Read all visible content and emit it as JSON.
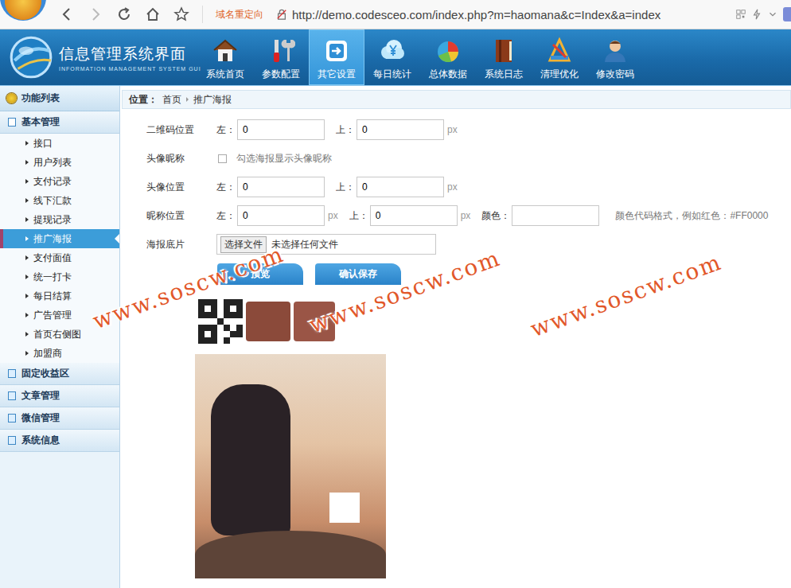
{
  "browser": {
    "redirect_label": "域名重定向",
    "url": "http://demo.codesceo.com/index.php?m=haomana&c=Index&a=index"
  },
  "header": {
    "title": "信息管理系统界面",
    "subtitle": "INFORMATION MANAGEMENT SYSTEM GUI",
    "nav": [
      {
        "label": "系统首页",
        "selected": false
      },
      {
        "label": "参数配置",
        "selected": false
      },
      {
        "label": "其它设置",
        "selected": true
      },
      {
        "label": "每日统计",
        "selected": false
      },
      {
        "label": "总体数据",
        "selected": false
      },
      {
        "label": "系统日志",
        "selected": false
      },
      {
        "label": "清理优化",
        "selected": false
      },
      {
        "label": "修改密码",
        "selected": false
      }
    ]
  },
  "sidebar": {
    "title": "功能列表",
    "groups": [
      {
        "label": "基本管理",
        "expanded": true,
        "items": [
          {
            "label": "接口",
            "selected": false
          },
          {
            "label": "用户列表",
            "selected": false
          },
          {
            "label": "支付记录",
            "selected": false
          },
          {
            "label": "线下汇款",
            "selected": false
          },
          {
            "label": "提现记录",
            "selected": false
          },
          {
            "label": "推广海报",
            "selected": true
          },
          {
            "label": "支付面值",
            "selected": false
          },
          {
            "label": "统一打卡",
            "selected": false
          },
          {
            "label": "每日结算",
            "selected": false
          },
          {
            "label": "广告管理",
            "selected": false
          },
          {
            "label": "首页右侧图",
            "selected": false
          },
          {
            "label": "加盟商",
            "selected": false
          }
        ]
      },
      {
        "label": "固定收益区",
        "expanded": false,
        "items": []
      },
      {
        "label": "文章管理",
        "expanded": false,
        "items": []
      },
      {
        "label": "微信管理",
        "expanded": false,
        "items": []
      },
      {
        "label": "系统信息",
        "expanded": false,
        "items": []
      }
    ]
  },
  "breadcrumb": {
    "prefix": "位置：",
    "items": [
      "首页",
      "推广海报"
    ]
  },
  "form": {
    "rows": [
      {
        "kind": "fields",
        "label": "二维码位置",
        "fields": [
          {
            "prefix": "左：",
            "value": "0"
          },
          {
            "prefix": "上：",
            "value": "0",
            "unit": "px"
          }
        ]
      },
      {
        "kind": "checkbox",
        "label": "头像昵称",
        "checked": false,
        "text": "勾选海报显示头像昵称"
      },
      {
        "kind": "fields",
        "label": "头像位置",
        "fields": [
          {
            "prefix": "左：",
            "value": "0"
          },
          {
            "prefix": "上：",
            "value": "0",
            "unit": "px"
          }
        ]
      },
      {
        "kind": "fields",
        "label": "昵称位置",
        "fields": [
          {
            "prefix": "左：",
            "value": "0",
            "unit": "px"
          },
          {
            "prefix": "上：",
            "value": "0",
            "unit": "px"
          },
          {
            "prefix": "颜色：",
            "value": ""
          }
        ],
        "hint": "颜色代码格式，例如红色：#FF0000"
      },
      {
        "kind": "file",
        "label": "海报底片",
        "button": "选择文件",
        "text": "未选择任何文件"
      }
    ],
    "buttons": [
      "预览",
      "确认保存"
    ]
  },
  "watermarks": [
    "www.soscw.com",
    "www.soscw.com",
    "www.soscw.com"
  ]
}
